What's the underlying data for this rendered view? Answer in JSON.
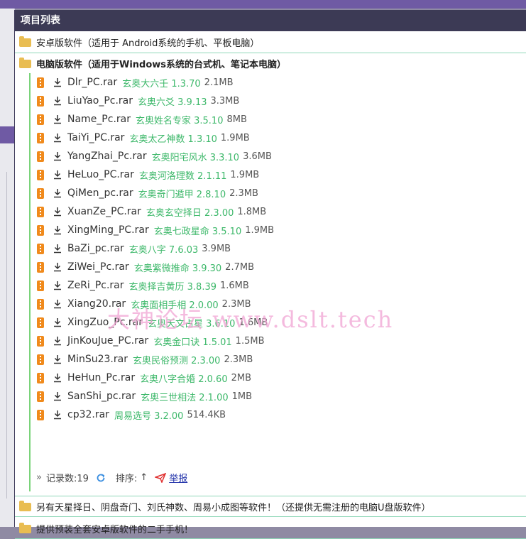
{
  "panel": {
    "title": "项目列表"
  },
  "folders": {
    "android": "安卓版软件（适用于 Android系统的手机、平板电脑）",
    "pc": "电脑版软件（适用于Windows系统的台式机、笔记本电脑）",
    "more": "另有天星择日、阴盘奇门、刘氏神数、周易小成图等软件！（还提供无需注册的电脑U盘版软件）",
    "phone": "提供预装全套安卓版软件的二手手机！"
  },
  "files": [
    {
      "name": "Dlr_PC.rar",
      "desc": "玄奥大六壬 1.3.70",
      "size": "2.1MB"
    },
    {
      "name": "LiuYao_Pc.rar",
      "desc": "玄奥六爻 3.9.13",
      "size": "3.3MB"
    },
    {
      "name": "Name_Pc.rar",
      "desc": "玄奥姓名专家 3.5.10",
      "size": "8MB"
    },
    {
      "name": "TaiYi_PC.rar",
      "desc": "玄奥太乙神数 1.3.10",
      "size": "1.9MB"
    },
    {
      "name": "YangZhai_Pc.rar",
      "desc": "玄奥阳宅风水 3.3.10",
      "size": "3.6MB"
    },
    {
      "name": "HeLuo_PC.rar",
      "desc": "玄奥河洛理数 2.1.11",
      "size": "1.9MB"
    },
    {
      "name": "QiMen_pc.rar",
      "desc": "玄奥奇门遁甲 2.8.10",
      "size": "2.3MB"
    },
    {
      "name": "XuanZe_PC.rar",
      "desc": "玄奥玄空择日 2.3.00",
      "size": "1.8MB"
    },
    {
      "name": "XingMing_PC.rar",
      "desc": "玄奥七政星命 3.5.10",
      "size": "1.9MB"
    },
    {
      "name": "BaZi_pc.rar",
      "desc": "玄奥八字 7.6.03",
      "size": "3.9MB"
    },
    {
      "name": "ZiWei_Pc.rar",
      "desc": "玄奥紫微推命 3.9.30",
      "size": "2.7MB"
    },
    {
      "name": "ZeRi_Pc.rar",
      "desc": "玄奥择吉黄历 3.8.39",
      "size": "1.6MB"
    },
    {
      "name": "Xiang20.rar",
      "desc": "玄奥面相手相 2.0.00",
      "size": "2.3MB"
    },
    {
      "name": "XingZuo_Pc.rar",
      "desc": "玄奥天文占星 3.6.10",
      "size": "1.6MB"
    },
    {
      "name": "JinKouJue_PC.rar",
      "desc": "玄奥金口诀 1.5.01",
      "size": "1.5MB"
    },
    {
      "name": "MinSu23.rar",
      "desc": "玄奥民俗预测 2.3.00",
      "size": "2.3MB"
    },
    {
      "name": "HeHun_Pc.rar",
      "desc": "玄奥八字合婚 2.0.60",
      "size": "2MB"
    },
    {
      "name": "SanShi_pc.rar",
      "desc": "玄奥三世相法 2.1.00",
      "size": "1MB"
    },
    {
      "name": "cp32.rar",
      "desc": "周易选号 3.2.00",
      "size": "514.4KB"
    }
  ],
  "footer": {
    "more_glyph": "»",
    "record_count": "记录数:19",
    "sort_label": "排序:",
    "sort_arrow": "↑",
    "report": "举报"
  },
  "watermark": "大神论坛  www.dslt.tech",
  "colors": {
    "header_bg": "#3c3a55",
    "accent_green": "#3db86a",
    "folder": "#e9bd52",
    "archive": "#f08a1c"
  },
  "icons": [
    "folder-icon",
    "archive-icon",
    "download-icon",
    "refresh-icon",
    "report-icon"
  ]
}
